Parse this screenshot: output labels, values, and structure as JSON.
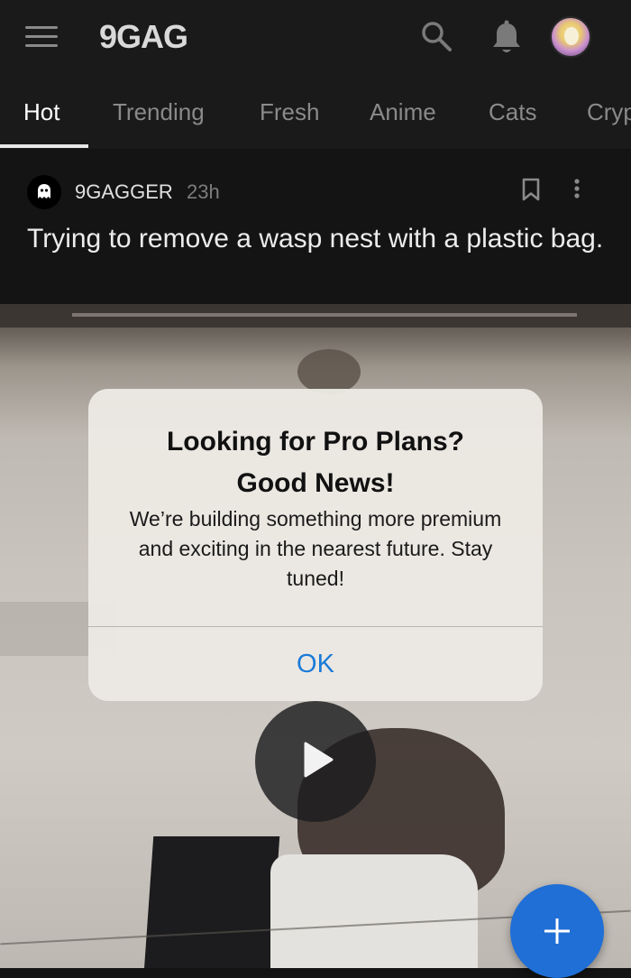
{
  "app": {
    "logo_text": "9GAG",
    "icons": [
      "menu-icon",
      "search-icon",
      "bell-icon",
      "avatar"
    ]
  },
  "tabs": [
    {
      "label": "Hot",
      "active": true
    },
    {
      "label": "Trending",
      "active": false
    },
    {
      "label": "Fresh",
      "active": false
    },
    {
      "label": "Anime",
      "active": false
    },
    {
      "label": "Cats",
      "active": false
    },
    {
      "label": "Cryp",
      "active": false
    }
  ],
  "post": {
    "author": "9GAGGER",
    "time": "23h",
    "title": "Trying to remove a wasp nest with a plastic bag.",
    "icons": [
      "bookmark-icon",
      "more-icon",
      "play-icon"
    ]
  },
  "dialog": {
    "title_line1": "Looking for Pro Plans?",
    "title_line2": "Good News!",
    "message": "We’re building something more premium and exciting in the nearest future. Stay tuned!",
    "ok_label": "OK"
  },
  "fab": {
    "icon": "plus-icon"
  },
  "colors": {
    "background": "#141414",
    "accent_blue": "#1f6fd6",
    "link_blue": "#1a7bd8",
    "dialog_bg": "#ece9e4"
  }
}
